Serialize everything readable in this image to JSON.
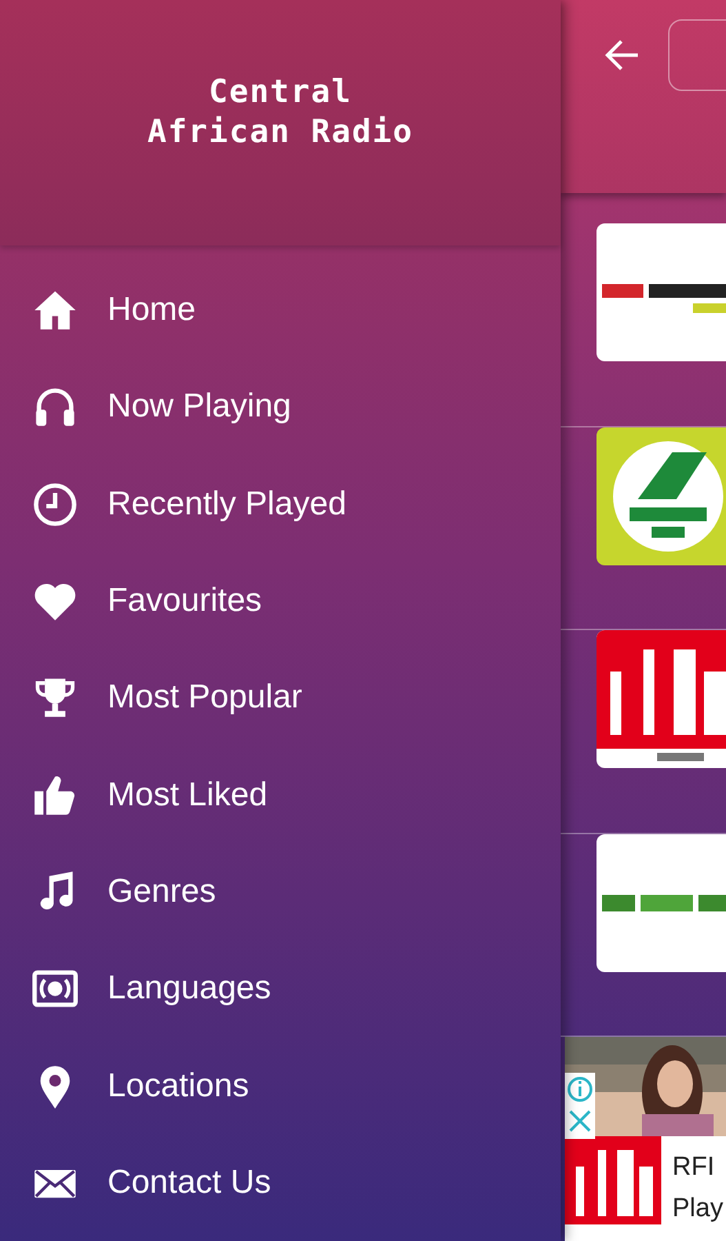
{
  "drawer": {
    "title_lines": [
      "Central",
      "African Radio"
    ],
    "items": [
      {
        "label": "Home"
      },
      {
        "label": "Now Playing"
      },
      {
        "label": "Recently Played"
      },
      {
        "label": "Favourites"
      },
      {
        "label": "Most Popular"
      },
      {
        "label": "Most Liked"
      },
      {
        "label": "Genres"
      },
      {
        "label": "Languages"
      },
      {
        "label": "Locations"
      },
      {
        "label": "Contact Us"
      }
    ]
  },
  "ad": {
    "title": "RFI",
    "subtitle": "Play"
  }
}
